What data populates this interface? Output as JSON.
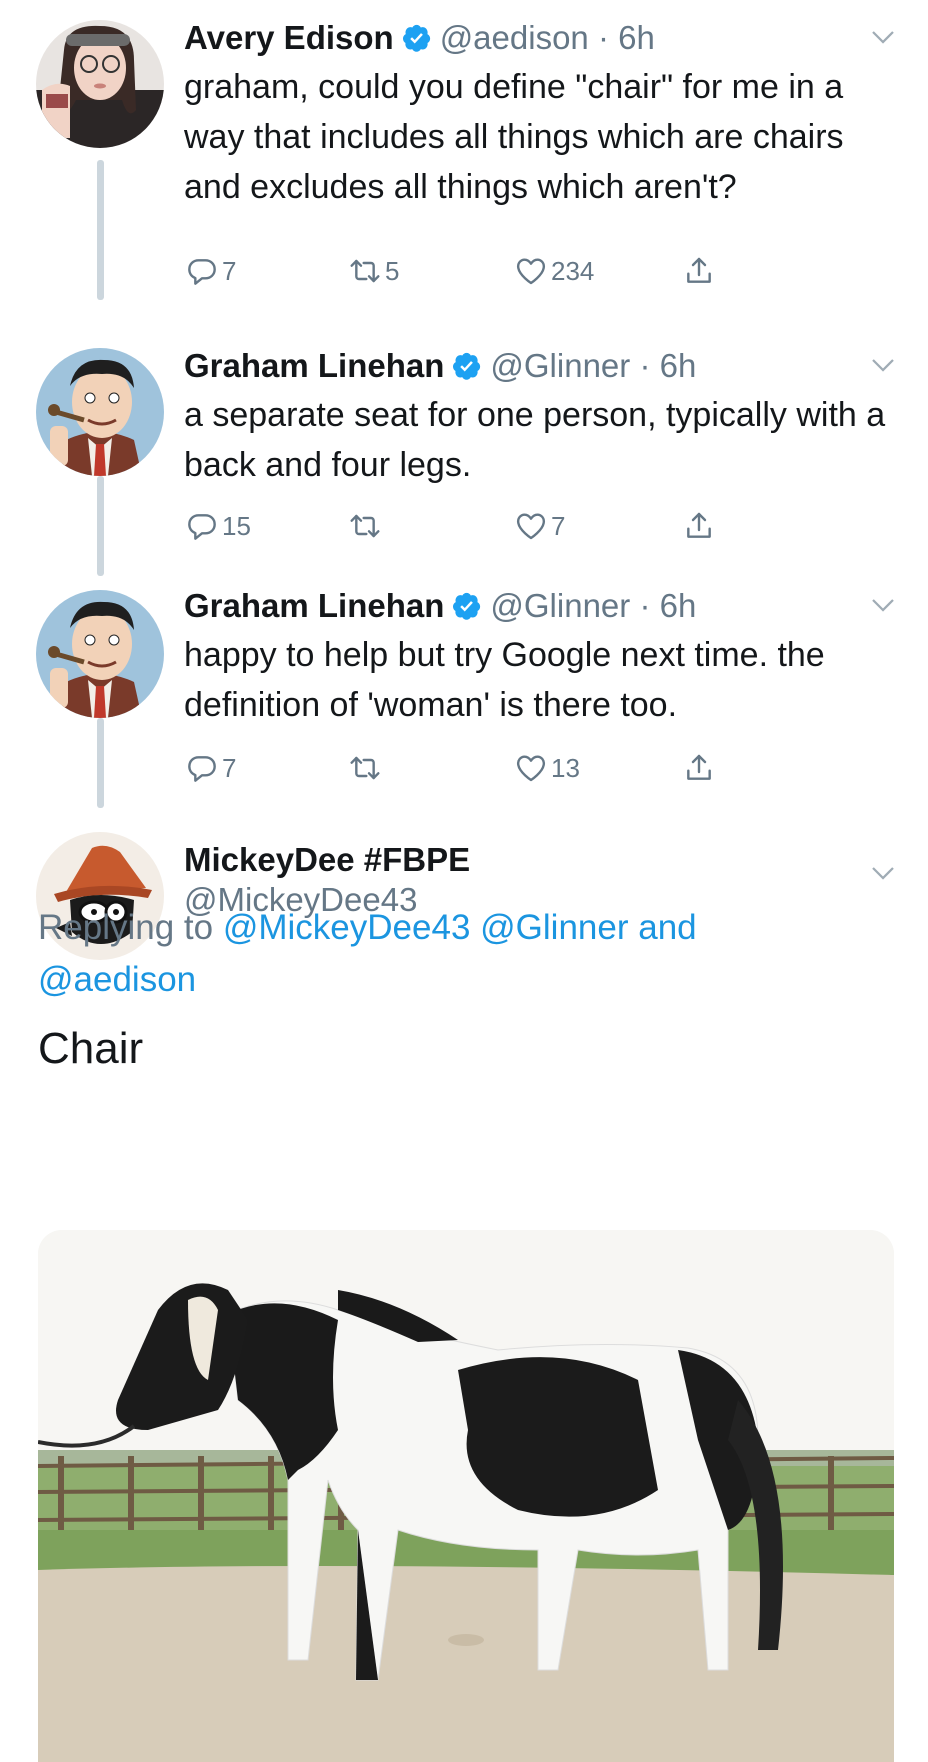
{
  "tweets": [
    {
      "name": "Avery Edison",
      "handle": "@aedison",
      "time": "6h",
      "text": "graham, could you define \"chair\" for me in a way that includes all things which are chairs and excludes all things which aren't?",
      "replies": "7",
      "retweets": "5",
      "likes": "234"
    },
    {
      "name": "Graham Linehan",
      "handle": "@Glinner",
      "time": "6h",
      "text": "a separate seat for one person, typically with a back and four legs.",
      "replies": "15",
      "retweets": "",
      "likes": "7"
    },
    {
      "name": "Graham Linehan",
      "handle": "@Glinner",
      "time": "6h",
      "text": "happy to help but try Google next time. the definition of 'woman' is there too.",
      "replies": "7",
      "retweets": "",
      "likes": "13"
    }
  ],
  "reply": {
    "name": "MickeyDee #FBPE",
    "handle": "@MickeyDee43",
    "replying_prefix": "Replying to",
    "mention1": "@MickeyDee43",
    "mention2": "@Glinner",
    "and": "and",
    "mention3": "@aedison",
    "text": "Chair"
  },
  "icons": {
    "verified": "verified-badge-icon",
    "caret": "chevron-down-icon",
    "reply": "comment-icon",
    "retweet": "retweet-icon",
    "like": "heart-icon",
    "share": "share-icon"
  },
  "colors": {
    "text": "#14171a",
    "secondary": "#657786",
    "link": "#1b95e0",
    "verified": "#1da1f2",
    "thread_line": "#ccd6dd"
  }
}
